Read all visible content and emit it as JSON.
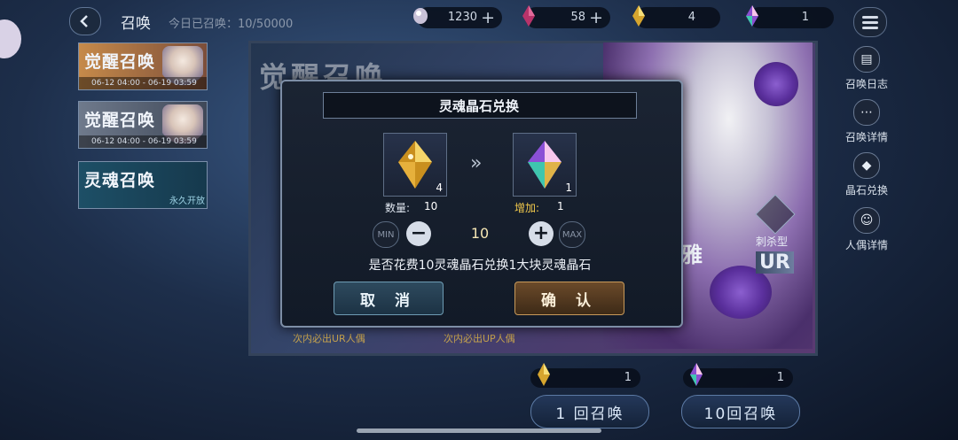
{
  "header": {
    "title": "召唤",
    "daily_count": "今日已召唤：10/50000"
  },
  "resources": [
    {
      "icon": "soul-orb-icon",
      "value": "1230"
    },
    {
      "icon": "red-crystal-icon",
      "value": "58"
    },
    {
      "icon": "soul-crystal-icon",
      "value": "4"
    },
    {
      "icon": "large-soul-crystal-icon",
      "value": "1"
    }
  ],
  "left_cards": [
    {
      "title": "觉醒召唤",
      "date": "06-12 04:00 - 06-19 03:59"
    },
    {
      "title": "觉醒召唤",
      "date": "06-12 04:00 - 06-19 03:59"
    },
    {
      "title": "灵魂召唤",
      "tag": "永久开放"
    }
  ],
  "side_nav": [
    {
      "label": "召唤日志",
      "icon": "log-icon"
    },
    {
      "label": "召唤详情",
      "icon": "details-icon"
    },
    {
      "label": "晶石兑换",
      "icon": "crystal-exchange-icon"
    },
    {
      "label": "人偶详情",
      "icon": "doll-details-icon"
    }
  ],
  "banner": {
    "title": "觉醒召唤",
    "class_label": "刺杀型",
    "rarity": "UR",
    "name_fragment": "雅",
    "note_1": "次内必出UR人偶",
    "note_2": "次内必出UP人偶"
  },
  "dialog": {
    "title": "灵魂晶石兑换",
    "from_count": "4",
    "to_count": "1",
    "qty_label": "数量:",
    "qty_value": "10",
    "gain_label": "增加:",
    "gain_value": "1",
    "min_label": "MIN",
    "max_label": "MAX",
    "minus": "−",
    "plus": "+",
    "amount": "10",
    "message": "是否花费10灵魂晶石兑换1大块灵魂晶石",
    "cancel": "取 消",
    "confirm": "确 认",
    "arrow": "»"
  },
  "bottom": {
    "cost_1": "1",
    "cost_10": "1",
    "summon_1": "1 回召唤",
    "summon_10": "10回召唤"
  },
  "colors": {
    "gold": "#f2c94c",
    "accent": "#c89a5a",
    "panel": "#121a27"
  }
}
